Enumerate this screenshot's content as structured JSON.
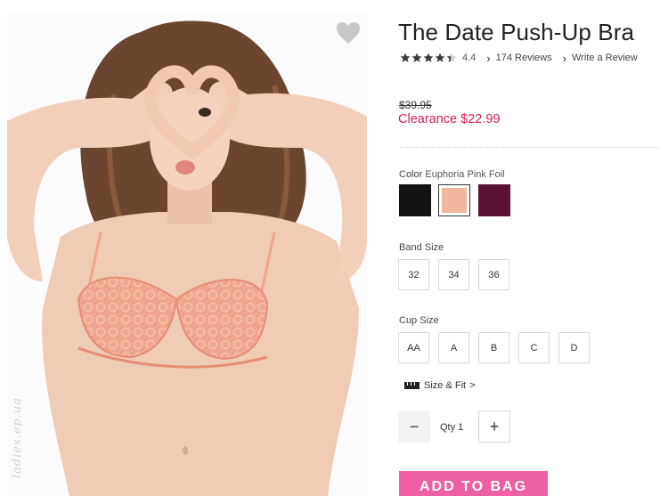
{
  "product": {
    "title": "The Date Push-Up Bra",
    "rating_value": "4.4",
    "rating_stars": 4.4,
    "reviews_link": "174 Reviews",
    "write_review_link": "Write a Review",
    "original_price": "$39.95",
    "clearance_price": "Clearance $22.99",
    "image_alt_icon": "product-photo",
    "wishlist_icon": "heart-icon",
    "watermark_text": "ladies.ep.ua"
  },
  "color": {
    "label": "Color",
    "selected_name": "Euphoria Pink Foil",
    "swatches": [
      {
        "name": "Black",
        "hex": "#121212"
      },
      {
        "name": "Euphoria Pink Foil",
        "hex": "#f1b69e"
      },
      {
        "name": "Burgundy",
        "hex": "#5a1232"
      }
    ]
  },
  "band_size": {
    "label": "Band Size",
    "options": [
      "32",
      "34",
      "36"
    ]
  },
  "cup_size": {
    "label": "Cup Size",
    "options": [
      "AA",
      "A",
      "B",
      "C",
      "D"
    ]
  },
  "size_fit": {
    "label": "Size & Fit",
    "chevron": ">",
    "icon": "ruler-icon"
  },
  "quantity": {
    "minus": "−",
    "label": "Qty 1",
    "plus": "+"
  },
  "cta": {
    "add_to_bag": "ADD TO BAG"
  },
  "colors": {
    "accent_pink": "#ee5fa3",
    "sale_red": "#d41f5a",
    "skin": "#f0cbb5",
    "hair": "#6b4530"
  }
}
